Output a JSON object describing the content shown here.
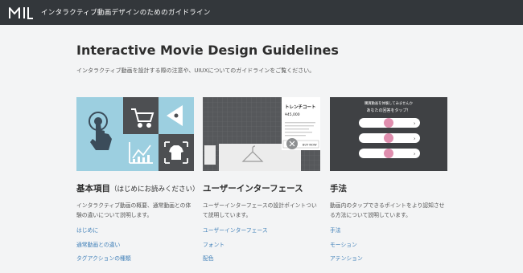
{
  "header": {
    "logo_text": "MIL",
    "title": "インタラクティブ動画デザインのためのガイドライン"
  },
  "main": {
    "title": "Interactive Movie Design Guidelines",
    "description": "インタラクティブ動画を設計する際の注意や、UIUXについてのガイドラインをご覧ください。"
  },
  "cards": [
    {
      "title": "基本項目",
      "title_sub": "（はじめにお読みください）",
      "description": "インタラクティブ動画の概要、通常動画との体験の違いについて説明します。",
      "links": [
        "はじめに",
        "通常動画との違い",
        "タグアクションの種類"
      ]
    },
    {
      "title": "ユーザーインターフェース",
      "description": "ユーザーインターフェースの設計ポイントついて説明しています。",
      "thumb": {
        "product_title": "トレンチコート",
        "price": "¥45,000",
        "button": "BUY NOW"
      },
      "links": [
        "ユーザーインターフェース",
        "フォント",
        "配色"
      ]
    },
    {
      "title": "手法",
      "description": "動画内のタップできるポイントをより認知させる方法について説明しています。",
      "thumb": {
        "caption_line1": "購買動画を体験してみませんか",
        "caption_line2": "あなたの回答をタップ！"
      },
      "links": [
        "手法",
        "モーション",
        "アテンション"
      ]
    }
  ],
  "colors": {
    "header_bg": "#33373b",
    "page_bg": "#f3f4f5",
    "link": "#3f7fb8",
    "thumb_blue": "#9ccfe0",
    "thumb_dark": "#4d4f52",
    "accent_pink": "#d97aa0"
  }
}
